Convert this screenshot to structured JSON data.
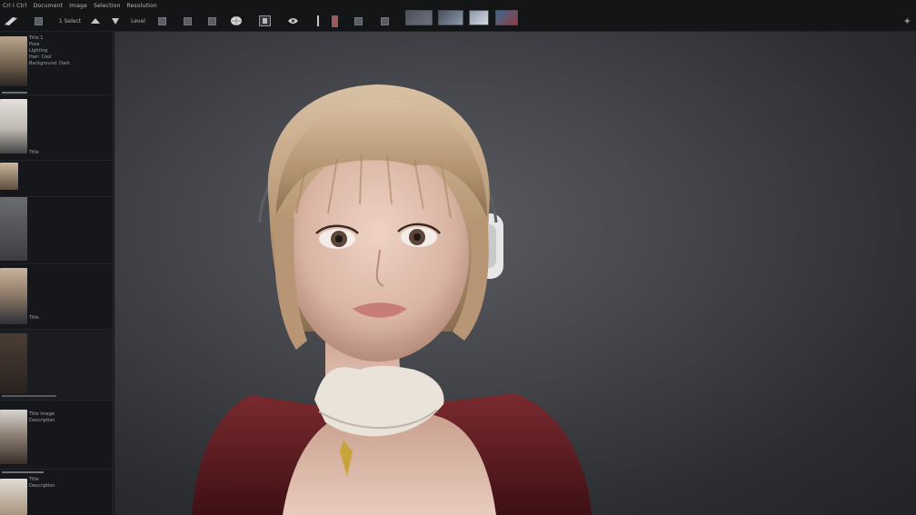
{
  "menu": {
    "items": [
      "Crl I Ctrl",
      "Document",
      "Image",
      "Selection",
      "Resolution"
    ]
  },
  "toolbar": {
    "zoom_label": "1 Select",
    "mode_label": "Level",
    "icons": [
      "brush-icon",
      "square-icon",
      "move-icon",
      "cursor-icon",
      "rect-icon",
      "rect-icon",
      "rect-icon",
      "globe-icon",
      "frame-icon",
      "eye-icon",
      "line-icon",
      "color-swatch-icon",
      "rect-icon",
      "rect-icon"
    ]
  },
  "sidebar": {
    "items": [
      {
        "lines": [
          "Title 1",
          "Pose",
          "Lighting",
          "Hair: Cool",
          "Background: Dark"
        ]
      },
      {
        "lines": [
          "Title"
        ]
      },
      {
        "lines": []
      },
      {
        "lines": [
          "Title"
        ]
      },
      {
        "lines": []
      },
      {
        "lines": [
          "Title Image",
          "Description"
        ]
      },
      {
        "lines": [
          "Title",
          "Description"
        ]
      }
    ]
  },
  "accent_color": "#7a1d22",
  "status": {
    "sparkle_icon": "sparkle-icon"
  }
}
